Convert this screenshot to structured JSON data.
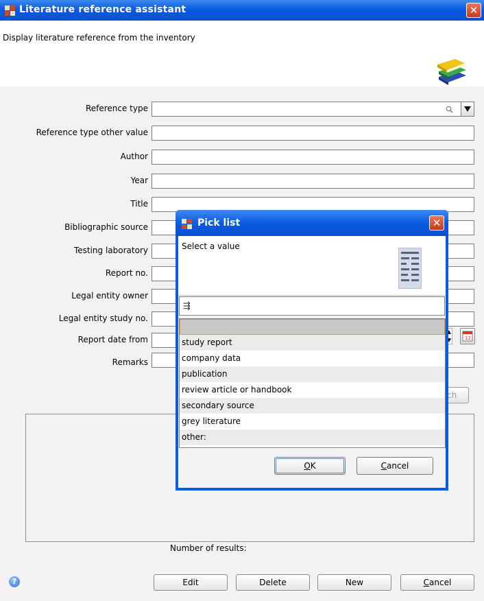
{
  "window": {
    "title": "Literature reference assistant",
    "close_glyph": "✕"
  },
  "header": {
    "description": "Display literature reference from the inventory",
    "icon": "books-icon"
  },
  "form": {
    "fields": [
      {
        "label": "Reference type",
        "value": ""
      },
      {
        "label": "Reference type other value",
        "value": ""
      },
      {
        "label": "Author",
        "value": ""
      },
      {
        "label": "Year",
        "value": ""
      },
      {
        "label": "Title",
        "value": ""
      },
      {
        "label": "Bibliographic source",
        "value": ""
      },
      {
        "label": "Testing laboratory",
        "value": ""
      },
      {
        "label": "Report no.",
        "value": ""
      },
      {
        "label": "Legal entity owner",
        "value": ""
      },
      {
        "label": "Legal entity study no.",
        "value": ""
      },
      {
        "label": "Report date from",
        "value": ""
      },
      {
        "label": "Remarks",
        "value": ""
      }
    ],
    "search_button_fragment": "ch",
    "results_label": "Number of results:"
  },
  "footer": {
    "help_glyph": "?",
    "buttons": {
      "edit": "Edit",
      "delete": "Delete",
      "new": "New",
      "cancel_rest": "ancel",
      "cancel_mnemonic": "C"
    }
  },
  "picklist": {
    "title": "Pick list",
    "close_glyph": "✕",
    "description": "Select a value",
    "filter_value": "",
    "items": [
      "",
      "study report",
      "company data",
      "publication",
      "review article or handbook",
      "secondary source",
      "grey literature",
      "other:"
    ],
    "selected_index": 0,
    "ok_mnemonic": "O",
    "ok_rest": "K",
    "cancel_mnemonic": "C",
    "cancel_rest": "ancel"
  },
  "colors": {
    "title_bar": "#0a5be0",
    "close": "#c8391c",
    "selection_border": "#e69b2c"
  }
}
